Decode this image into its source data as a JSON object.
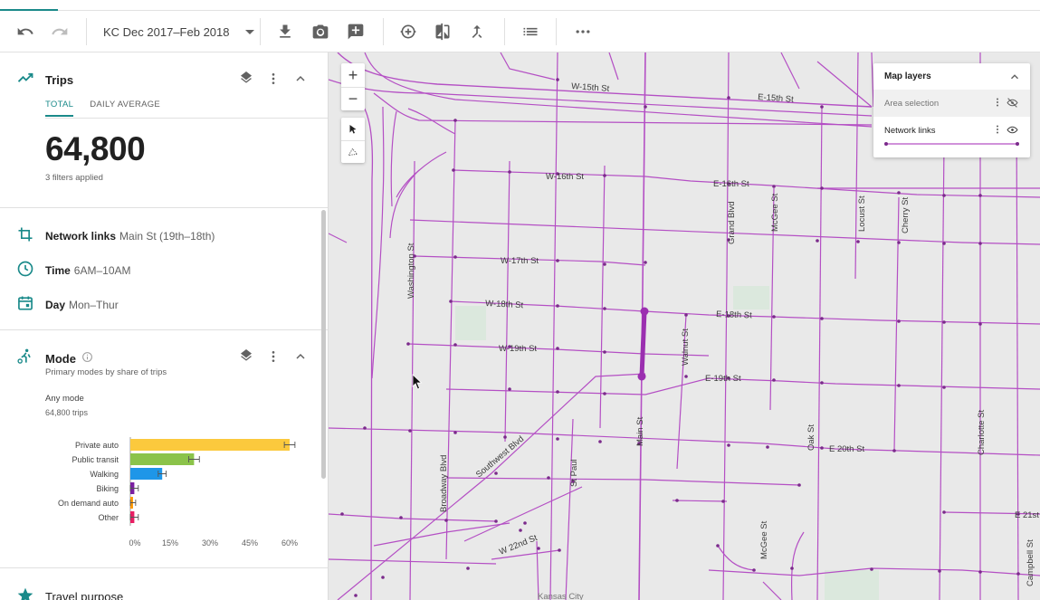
{
  "toolbar": {
    "date_range": "KC Dec 2017–Feb 2018",
    "icons": [
      "undo-icon",
      "redo-icon",
      "download-icon",
      "camera-icon",
      "add-comment-icon",
      "add-layer-icon",
      "compare-icon",
      "merge-icon",
      "list-icon",
      "more-icon"
    ]
  },
  "trips": {
    "title": "Trips",
    "tabs": [
      "TOTAL",
      "DAILY AVERAGE"
    ],
    "active_tab": "TOTAL",
    "count": "64,800",
    "filters_note": "3 filters applied"
  },
  "filters": [
    {
      "label": "Network links",
      "value": "Main St (19th–18th)"
    },
    {
      "label": "Time",
      "value": "6AM–10AM"
    },
    {
      "label": "Day",
      "value": "Mon–Thur"
    }
  ],
  "mode": {
    "title": "Mode",
    "subtitle": "Primary modes by share of trips",
    "any_mode": "Any mode",
    "any_trips": "64,800 trips"
  },
  "chart_data": {
    "type": "bar",
    "orientation": "horizontal",
    "categories": [
      "Private auto",
      "Public transit",
      "Walking",
      "Biking",
      "On demand auto",
      "Other"
    ],
    "values": [
      60,
      24,
      12,
      1.5,
      1,
      1.5
    ],
    "error": [
      2,
      2,
      1.5,
      1.5,
      1,
      1.5
    ],
    "colors": [
      "#fbc93d",
      "#8bc34a",
      "#1e96e8",
      "#7b1fa2",
      "#ff9800",
      "#e91e63"
    ],
    "xticks": [
      "0%",
      "15%",
      "30%",
      "45%",
      "60%"
    ],
    "xlim": [
      0,
      60
    ]
  },
  "travel_purpose": {
    "title": "Travel purpose"
  },
  "map": {
    "zoom_in": "+",
    "zoom_out": "−",
    "layers_title": "Map layers",
    "layers": [
      {
        "name": "Area selection",
        "visible": false
      },
      {
        "name": "Network links",
        "visible": true
      }
    ],
    "streets": {
      "w15": "W-15th St",
      "e15": "E-15th St",
      "w16": "W-16th St",
      "e16": "E-16th St",
      "w17": "W-17th St",
      "w18": "W-18th St",
      "e18": "E-18th St",
      "w19": "W-19th St",
      "e19": "E-19th St",
      "e20": "E 20th St",
      "w22": "W 22nd St",
      "e21": "E 21st",
      "washington": "Washington St",
      "grand": "Grand Blvd",
      "mcgee": "McGee St",
      "locust": "Locust St",
      "cherry": "Cherry St",
      "walnut": "Walnut St",
      "broadway": "Broadway Blvd",
      "southwest": "Southwest Blvd",
      "stpaul": "St Paul",
      "main": "Main St",
      "oak": "Oak St",
      "charlotte": "Charlotte St",
      "mcgee2": "McGee St",
      "campbell": "Campbell St",
      "kansas": "Kansas City"
    },
    "road_color": "#b44fc4",
    "highlight_color": "#9b2fb0"
  }
}
